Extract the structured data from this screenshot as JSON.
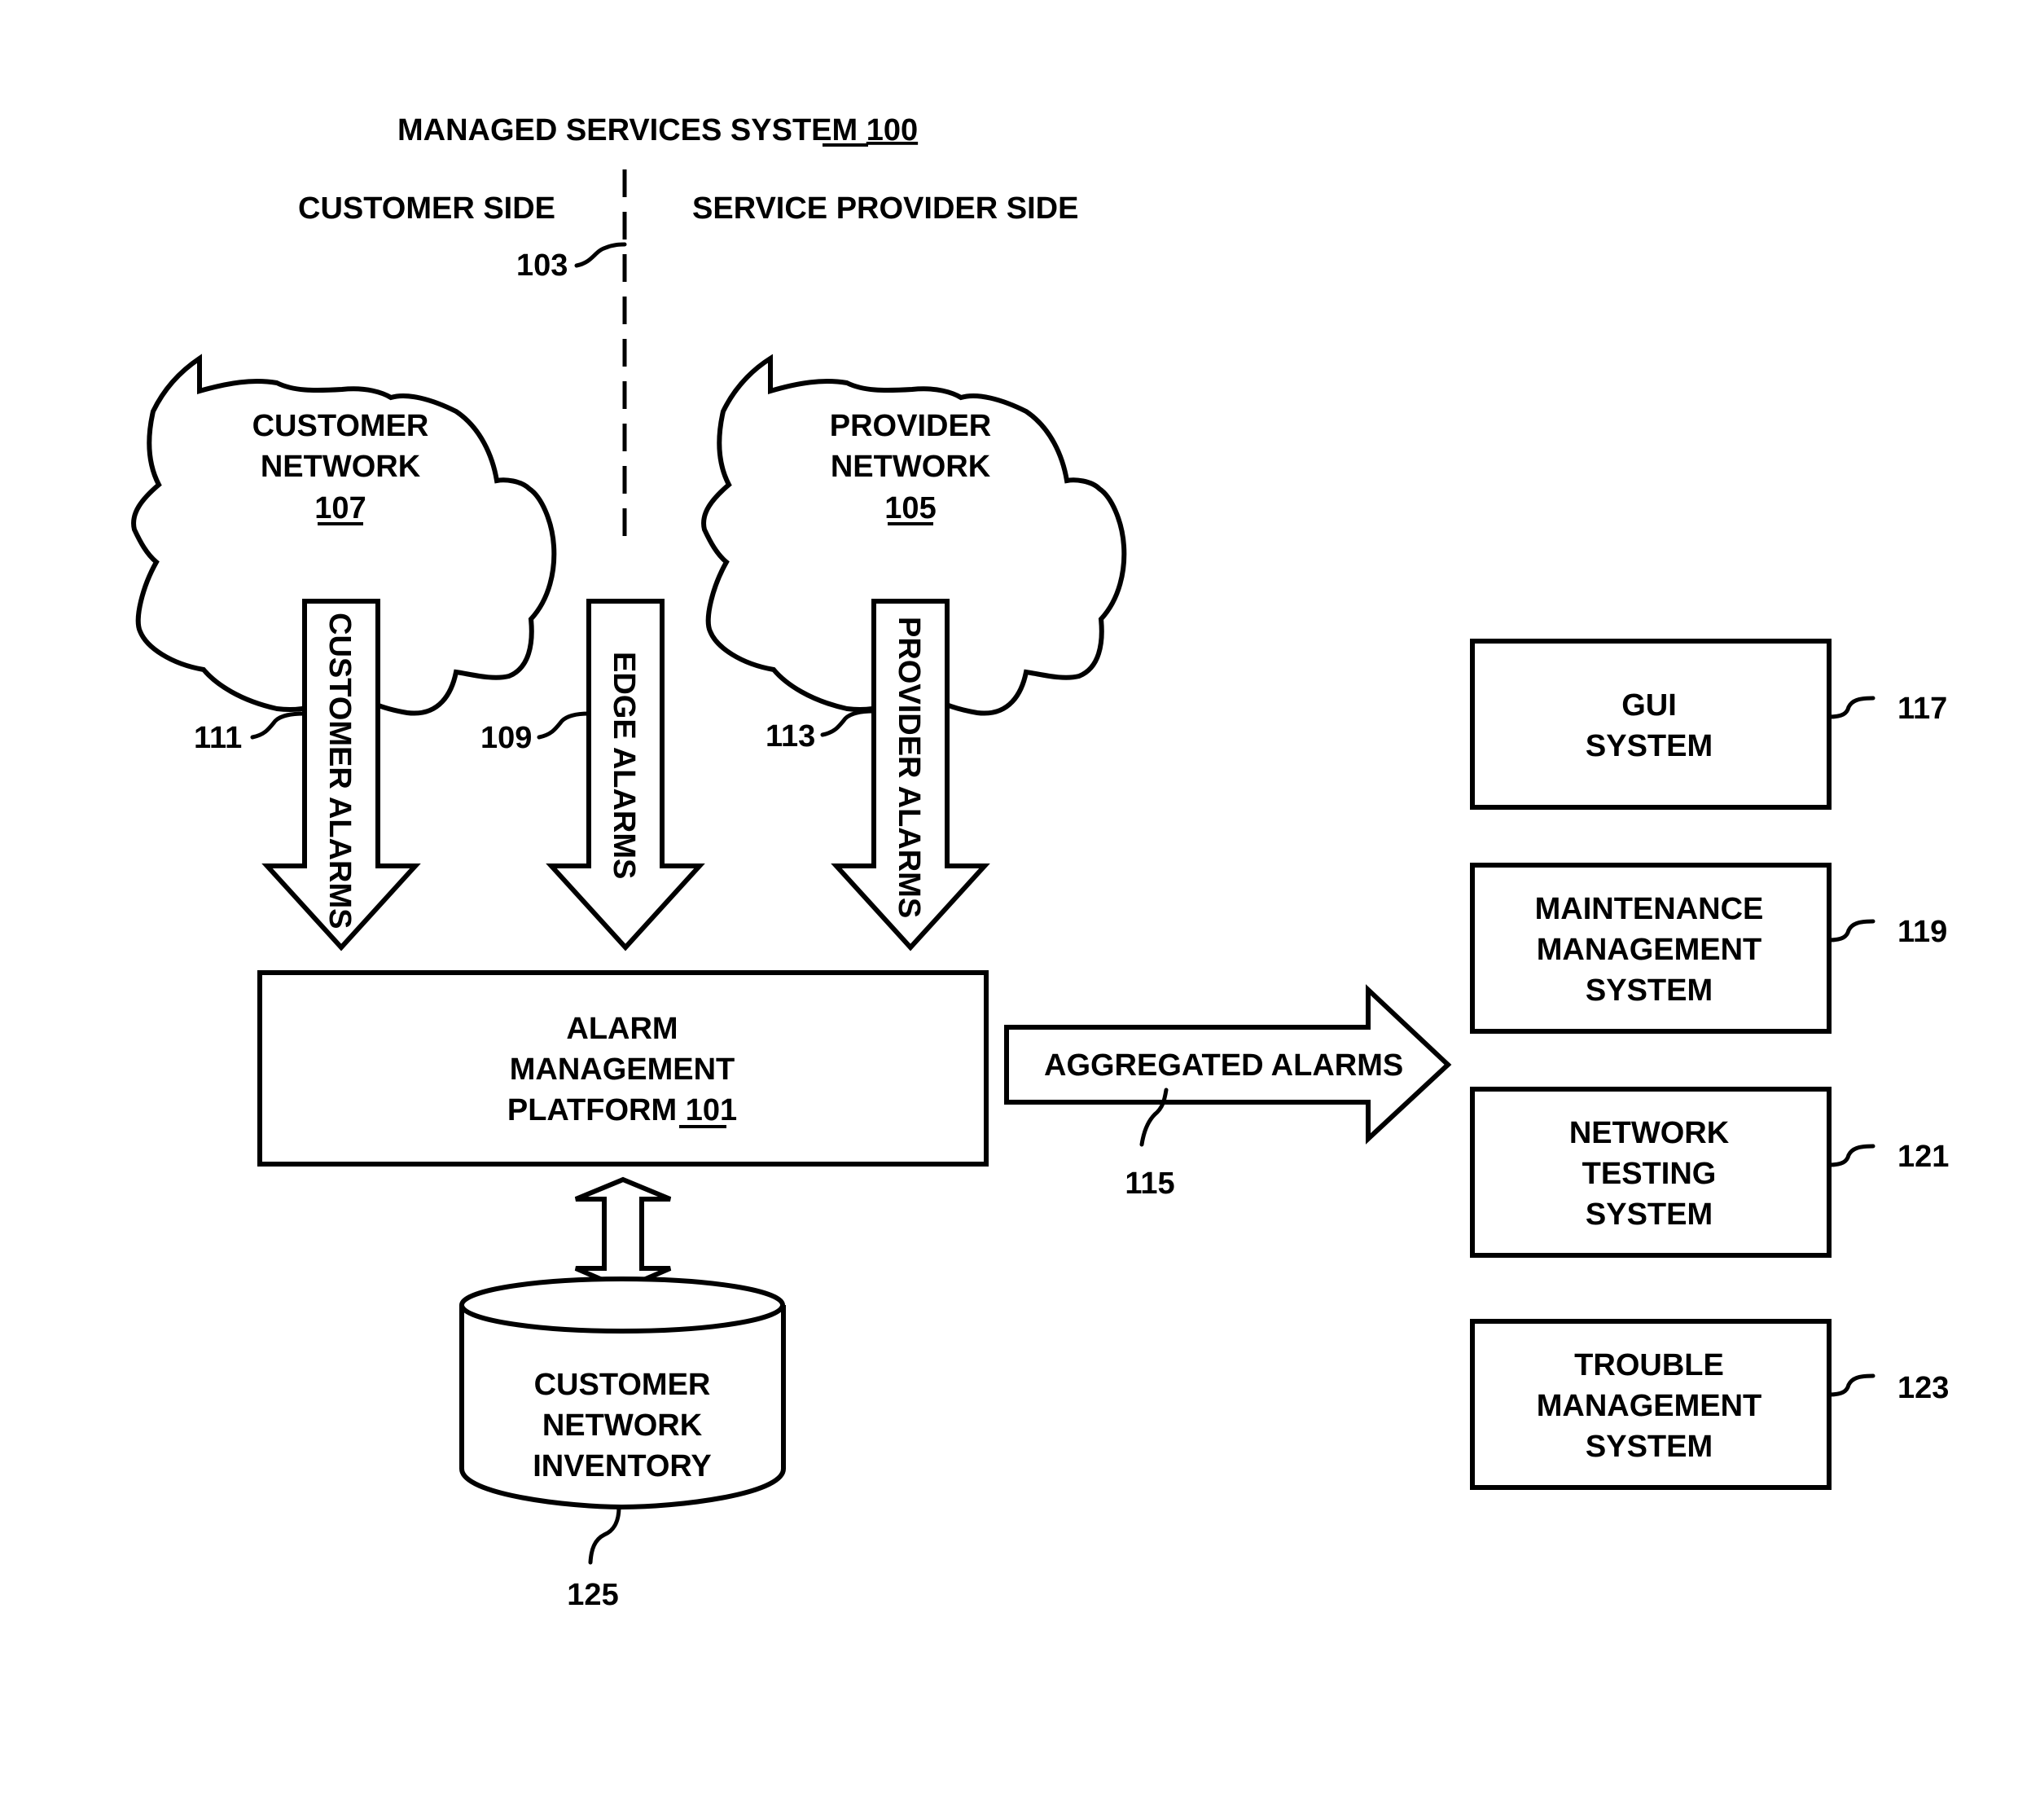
{
  "title": {
    "text": "MANAGED SERVICES SYSTEM ",
    "ref": "100"
  },
  "sides": {
    "customer": "CUSTOMER SIDE",
    "provider": "SERVICE PROVIDER SIDE",
    "divider_ref": "103"
  },
  "clouds": [
    {
      "lines": [
        "CUSTOMER",
        "NETWORK"
      ],
      "ref": "107"
    },
    {
      "lines": [
        "PROVIDER",
        "NETWORK"
      ],
      "ref": "105"
    }
  ],
  "alarm_arrows": [
    {
      "label": "CUSTOMER ALARMS",
      "ref": "111"
    },
    {
      "label": "EDGE ALARMS",
      "ref": "109"
    },
    {
      "label": "PROVIDER ALARMS",
      "ref": "113"
    }
  ],
  "platform": {
    "lines": [
      "ALARM",
      "MANAGEMENT",
      "PLATFORM "
    ],
    "ref": "101"
  },
  "aggregated": {
    "label": "AGGREGATED ALARMS",
    "ref": "115"
  },
  "systems": [
    {
      "lines": [
        "GUI",
        "SYSTEM"
      ],
      "ref": "117"
    },
    {
      "lines": [
        "MAINTENANCE",
        "MANAGEMENT",
        "SYSTEM"
      ],
      "ref": "119"
    },
    {
      "lines": [
        "NETWORK",
        "TESTING",
        "SYSTEM"
      ],
      "ref": "121"
    },
    {
      "lines": [
        "TROUBLE",
        "MANAGEMENT",
        "SYSTEM"
      ],
      "ref": "123"
    }
  ],
  "inventory": {
    "lines": [
      "CUSTOMER",
      "NETWORK",
      "INVENTORY"
    ],
    "ref": "125"
  }
}
